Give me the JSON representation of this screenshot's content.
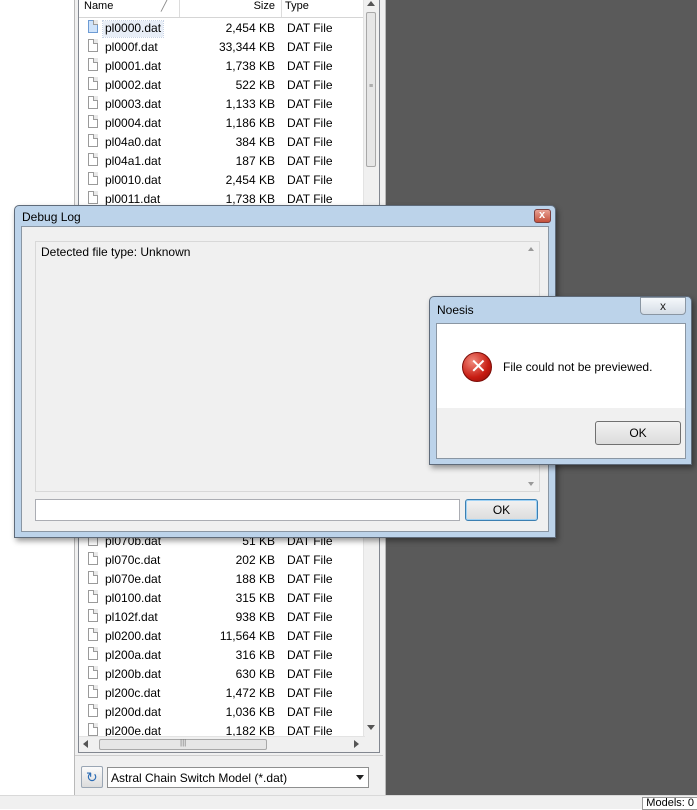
{
  "file_list": {
    "columns": {
      "name": "Name",
      "size": "Size",
      "type": "Type"
    },
    "rows_top": [
      {
        "name": "pl0000.dat",
        "size": "2,454 KB",
        "type": "DAT File",
        "selected": true
      },
      {
        "name": "pl000f.dat",
        "size": "33,344 KB",
        "type": "DAT File"
      },
      {
        "name": "pl0001.dat",
        "size": "1,738 KB",
        "type": "DAT File"
      },
      {
        "name": "pl0002.dat",
        "size": "522 KB",
        "type": "DAT File"
      },
      {
        "name": "pl0003.dat",
        "size": "1,133 KB",
        "type": "DAT File"
      },
      {
        "name": "pl0004.dat",
        "size": "1,186 KB",
        "type": "DAT File"
      },
      {
        "name": "pl04a0.dat",
        "size": "384 KB",
        "type": "DAT File"
      },
      {
        "name": "pl04a1.dat",
        "size": "187 KB",
        "type": "DAT File"
      },
      {
        "name": "pl0010.dat",
        "size": "2,454 KB",
        "type": "DAT File"
      },
      {
        "name": "pl0011.dat",
        "size": "1,738 KB",
        "type": "DAT File"
      }
    ],
    "rows_bottom": [
      {
        "name": "pl070b.dat",
        "size": "51 KB",
        "type": "DAT File"
      },
      {
        "name": "pl070c.dat",
        "size": "202 KB",
        "type": "DAT File"
      },
      {
        "name": "pl070e.dat",
        "size": "188 KB",
        "type": "DAT File"
      },
      {
        "name": "pl0100.dat",
        "size": "315 KB",
        "type": "DAT File"
      },
      {
        "name": "pl102f.dat",
        "size": "938 KB",
        "type": "DAT File"
      },
      {
        "name": "pl0200.dat",
        "size": "11,564 KB",
        "type": "DAT File"
      },
      {
        "name": "pl200a.dat",
        "size": "316 KB",
        "type": "DAT File"
      },
      {
        "name": "pl200b.dat",
        "size": "630 KB",
        "type": "DAT File"
      },
      {
        "name": "pl200c.dat",
        "size": "1,472 KB",
        "type": "DAT File"
      },
      {
        "name": "pl200d.dat",
        "size": "1,036 KB",
        "type": "DAT File"
      },
      {
        "name": "pl200e.dat",
        "size": "1,182 KB",
        "type": "DAT File"
      }
    ]
  },
  "filter": {
    "selected": "Astral Chain Switch Model (*.dat)"
  },
  "debug_log": {
    "title": "Debug Log",
    "log_text": "Detected file type: Unknown",
    "input_value": "",
    "ok_label": "OK"
  },
  "noesis_dialog": {
    "title": "Noesis",
    "message": "File could not be previewed.",
    "ok_label": "OK"
  },
  "status": {
    "models_label": "Models: 0"
  },
  "icons": {
    "file": "file-icon",
    "error": "error-icon",
    "refresh": "refresh-icon",
    "close": "close-icon"
  },
  "colors": {
    "workspace": "#5a5a5a",
    "error_red": "#c71c12",
    "title_bar": "#bcd3ea"
  }
}
